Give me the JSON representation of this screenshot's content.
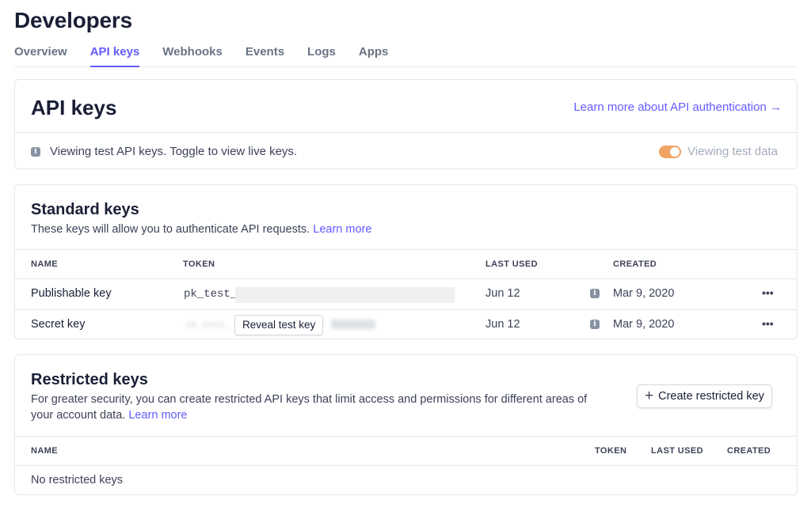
{
  "page": {
    "title": "Developers"
  },
  "tabs": [
    "Overview",
    "API keys",
    "Webhooks",
    "Events",
    "Logs",
    "Apps"
  ],
  "active_tab": "API keys",
  "api_keys_card": {
    "title": "API keys",
    "learn_link": "Learn more about API authentication →",
    "info_text": "Viewing test API keys. Toggle to view live keys.",
    "toggle_label": "Viewing test data",
    "toggle_on": true
  },
  "standard_keys": {
    "title": "Standard keys",
    "description": "These keys will allow you to authenticate API requests.",
    "learn_more": "Learn more",
    "columns": {
      "name": "NAME",
      "token": "TOKEN",
      "last_used": "LAST USED",
      "created": "CREATED"
    },
    "rows": [
      {
        "name": "Publishable key",
        "token": "pk_test_",
        "last_used": "Jun 12",
        "created": "Mar 9, 2020",
        "menu": "•••"
      },
      {
        "name": "Secret key",
        "token_hidden": "sk_test_",
        "reveal": "Reveal test key",
        "last_used": "Jun 12",
        "created": "Mar 9, 2020",
        "menu": "•••"
      }
    ]
  },
  "restricted_keys": {
    "title": "Restricted keys",
    "description_line1": "For greater security, you can create restricted API keys that limit access and permissions for different areas of",
    "description_line2": "your account data.",
    "learn_more": "Learn more",
    "create_button": "Create restricted key",
    "columns": {
      "name": "NAME",
      "token": "TOKEN",
      "last_used": "LAST USED",
      "created": "CREATED"
    },
    "empty_text": "No restricted keys"
  },
  "colors": {
    "accent": "#635bff",
    "toggle": "#f0a565",
    "border": "#e3e8ee"
  }
}
